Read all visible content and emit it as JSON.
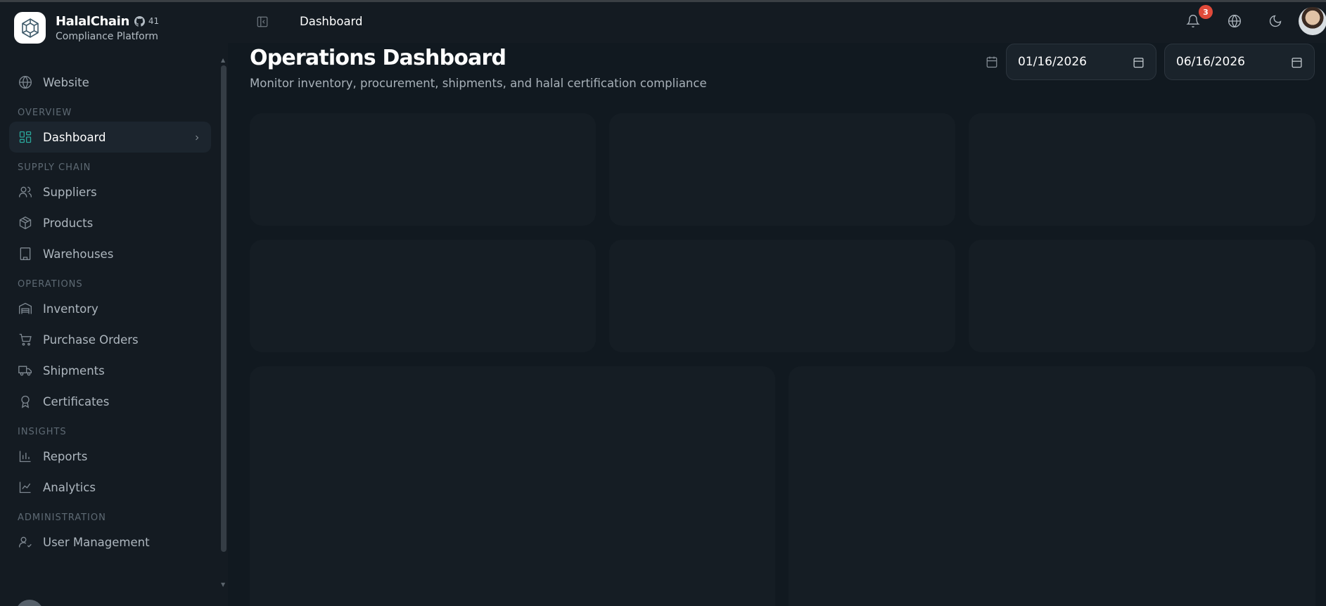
{
  "brand": {
    "name": "HalalChain",
    "stars": "41",
    "subtitle": "Compliance Platform"
  },
  "sidebar": {
    "website": "Website",
    "sections": [
      {
        "label": "OVERVIEW",
        "items": [
          {
            "label": "Dashboard",
            "icon": "layout-grid-icon",
            "active": true
          }
        ]
      },
      {
        "label": "SUPPLY CHAIN",
        "items": [
          {
            "label": "Suppliers",
            "icon": "users-icon"
          },
          {
            "label": "Products",
            "icon": "package-icon"
          },
          {
            "label": "Warehouses",
            "icon": "building-icon"
          }
        ]
      },
      {
        "label": "OPERATIONS",
        "items": [
          {
            "label": "Inventory",
            "icon": "warehouse-icon"
          },
          {
            "label": "Purchase Orders",
            "icon": "cart-icon"
          },
          {
            "label": "Shipments",
            "icon": "truck-icon"
          },
          {
            "label": "Certificates",
            "icon": "award-icon"
          }
        ]
      },
      {
        "label": "INSIGHTS",
        "items": [
          {
            "label": "Reports",
            "icon": "bar-chart-icon"
          },
          {
            "label": "Analytics",
            "icon": "line-chart-icon"
          }
        ]
      },
      {
        "label": "ADMINISTRATION",
        "items": [
          {
            "label": "User Management",
            "icon": "user-check-icon"
          }
        ]
      }
    ]
  },
  "topbar": {
    "breadcrumb": "Dashboard",
    "notification_count": "3"
  },
  "main": {
    "title": "Operations Dashboard",
    "subtitle": "Monitor inventory, procurement, shipments, and halal certification compliance",
    "date_from": "01/16/2026",
    "date_to": "06/16/2026"
  }
}
